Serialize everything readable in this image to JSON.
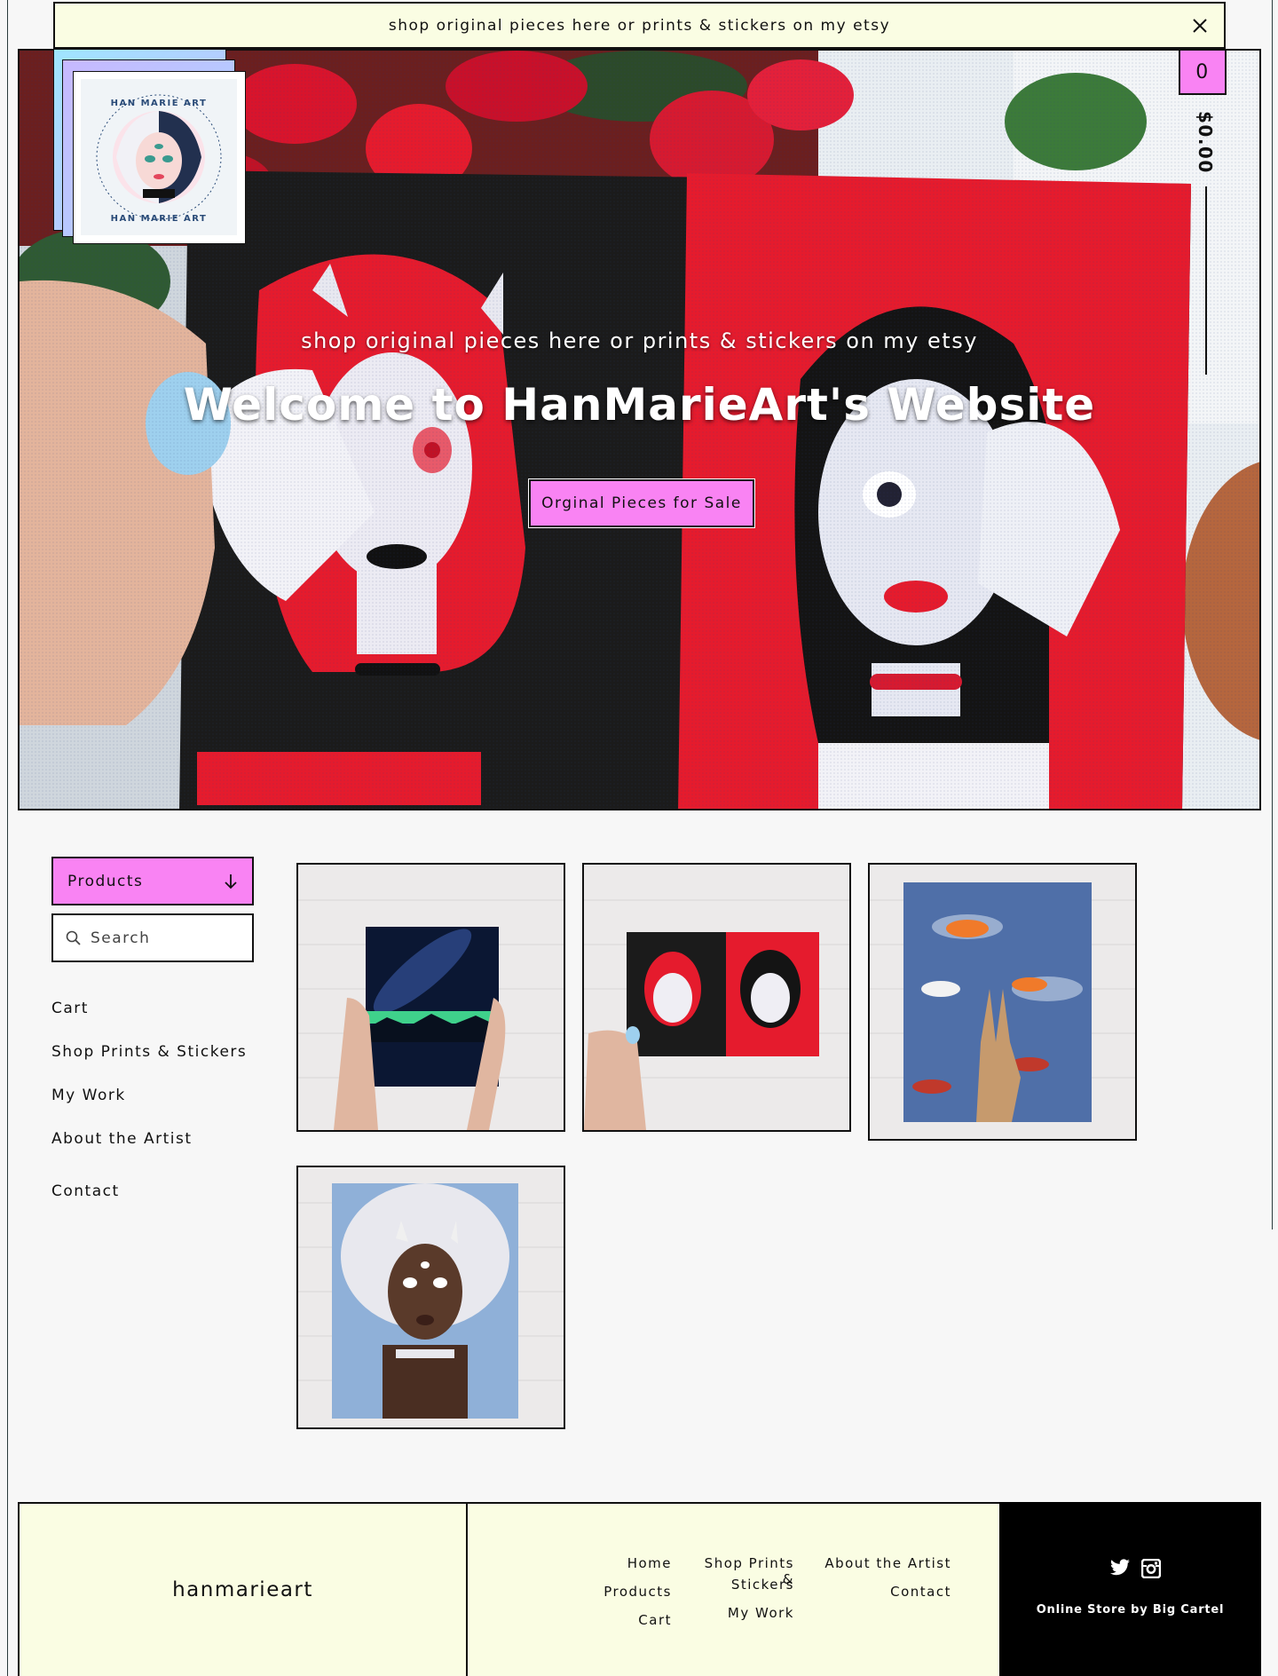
{
  "announcement": {
    "text": "shop original pieces here or prints & stickers on my etsy",
    "close_icon": "close-icon"
  },
  "logo": {
    "ring_top": "HAN MARIE ART",
    "ring_bottom": "HAN MARIE ART"
  },
  "cart": {
    "count": "0",
    "total": "$0.00"
  },
  "hero": {
    "subtitle": "shop original pieces here or prints & stickers on my etsy",
    "title": "Welcome to HanMarieArt's Website",
    "button_label": "Orginal Pieces for Sale"
  },
  "sidebar": {
    "products_label": "Products",
    "products_icon": "arrow-down-icon",
    "search_placeholder": "Search",
    "search_icon": "search-icon",
    "links": [
      "Cart",
      "Shop Prints & Stickers",
      "My Work",
      "About the Artist",
      "Contact"
    ]
  },
  "products": [
    {
      "subject": "galaxy-aurora-painting"
    },
    {
      "subject": "devil-girls-painting"
    },
    {
      "subject": "koi-fish-hand-painting"
    },
    {
      "subject": "afro-three-eyed-girl-painting"
    }
  ],
  "footer": {
    "brand": "hanmarieart",
    "col1": [
      "Home",
      "Products",
      "Cart"
    ],
    "col2_line1": "Shop Prints &",
    "col2_line2": "Stickers",
    "col2_my_work": "My Work",
    "col3": [
      "About the Artist",
      "Contact"
    ],
    "credit": "Online Store by Big Cartel",
    "social_icons": [
      "twitter-icon",
      "instagram-icon"
    ]
  },
  "colors": {
    "accent_pink": "#f983f3",
    "cream": "#fafde3",
    "red": "#e51b2d",
    "black": "#111111"
  }
}
